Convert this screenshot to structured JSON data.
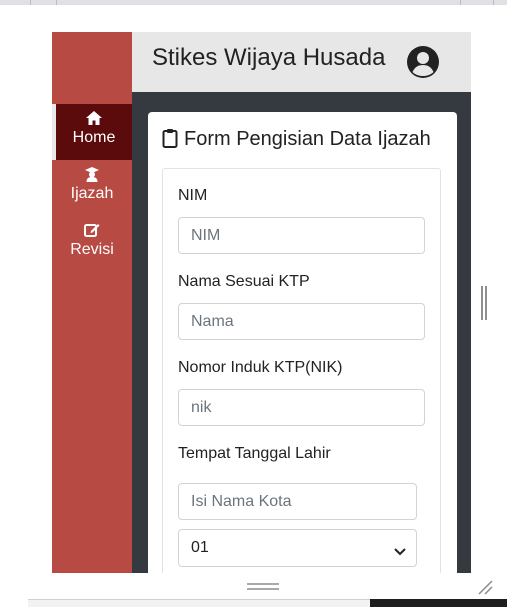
{
  "app": {
    "title": "Stikes Wijaya Husada"
  },
  "sidebar": {
    "items": [
      {
        "label": "Home",
        "icon": "home-icon",
        "active": true
      },
      {
        "label": "Ijazah",
        "icon": "graduate-icon",
        "active": false
      },
      {
        "label": "Revisi",
        "icon": "edit-icon",
        "active": false
      }
    ]
  },
  "form": {
    "title": "Form Pengisian Data Ijazah",
    "nim": {
      "label": "NIM",
      "placeholder": "NIM"
    },
    "nama": {
      "label": "Nama Sesuai KTP",
      "placeholder": "Nama"
    },
    "nik": {
      "label": "Nomor Induk KTP(NIK)",
      "placeholder": "nik"
    },
    "ttl": {
      "label": "Tempat Tanggal Lahir",
      "city_placeholder": "Isi Nama Kota",
      "day_value": "01"
    }
  },
  "colors": {
    "sidebar": "#b84a44",
    "sidebar_active": "#5b0b0b",
    "header": "#e7e7e7",
    "content_bg": "#343a40"
  }
}
